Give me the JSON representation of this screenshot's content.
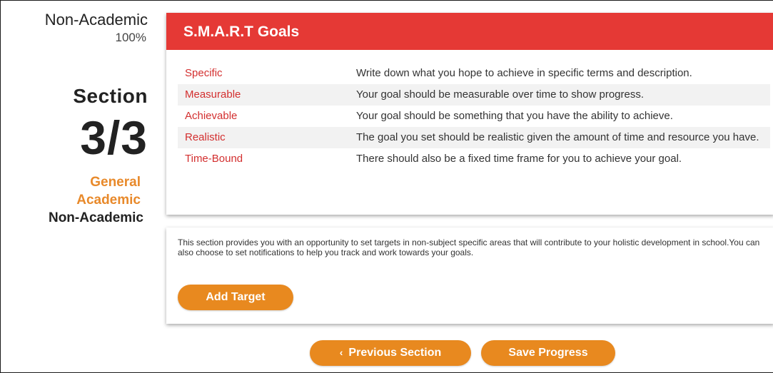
{
  "sidebar": {
    "heading": "Non-Academic",
    "percent": "100%",
    "section_label": "Section",
    "section_count": "3/3",
    "nav": [
      {
        "label": "General"
      },
      {
        "label": "Academic"
      },
      {
        "label": "Non-Academic"
      }
    ]
  },
  "smart": {
    "title": "S.M.A.R.T Goals",
    "rows": [
      {
        "term": "Specific",
        "desc": "Write down what you hope to achieve in specific terms and description."
      },
      {
        "term": "Measurable",
        "desc": "Your goal should be measurable over time to show progress."
      },
      {
        "term": "Achievable",
        "desc": "Your goal should be something that you have the ability to achieve."
      },
      {
        "term": "Realistic",
        "desc": "The goal you set should be realistic given the amount of time and resource you have."
      },
      {
        "term": "Time-Bound",
        "desc": "There should also be a fixed time frame for you to achieve your goal."
      }
    ]
  },
  "info": {
    "text": "This section provides you with an opportunity to set targets in non-subject specific areas that will contribute to your holistic development in school.You can also choose to set notifications to help you track and work towards your goals.",
    "add_target_label": "Add Target"
  },
  "footer": {
    "prev_label": "Previous Section",
    "save_label": "Save Progress"
  },
  "colors": {
    "header_red": "#e53935",
    "term_red": "#d32f2f",
    "button_orange": "#e8891f",
    "nav_orange": "#e8892a"
  }
}
